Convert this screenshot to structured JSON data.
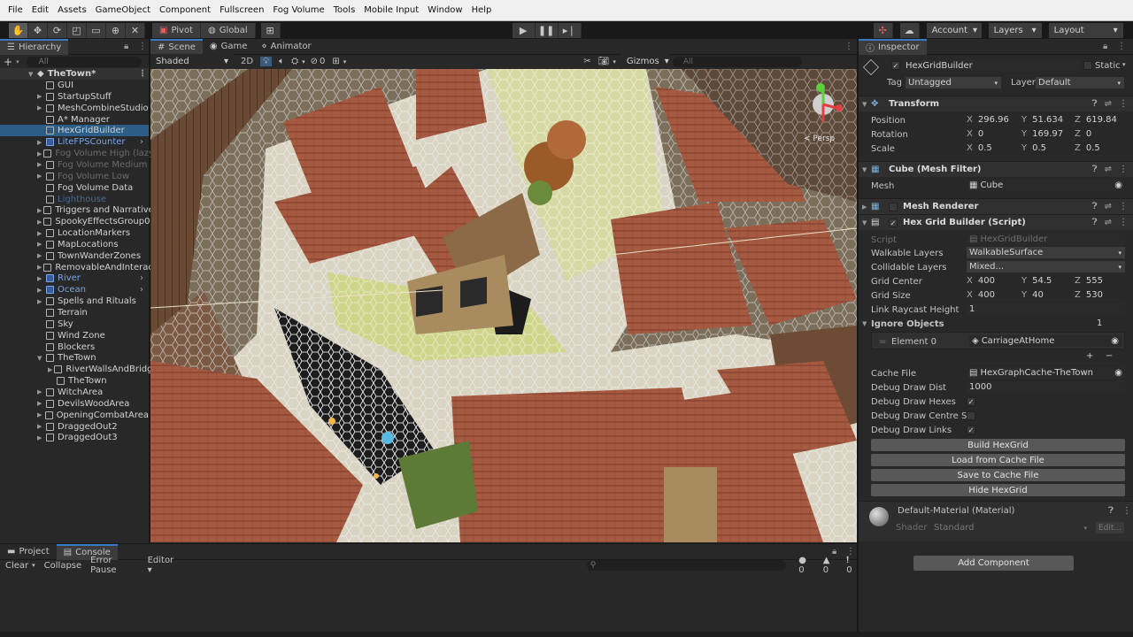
{
  "menu": [
    "File",
    "Edit",
    "Assets",
    "GameObject",
    "Component",
    "Fullscreen",
    "Fog Volume",
    "Tools",
    "Mobile Input",
    "Window",
    "Help"
  ],
  "toolbar": {
    "pivot": "Pivot",
    "global": "Global",
    "account": "Account",
    "layers": "Layers",
    "layout": "Layout"
  },
  "hierarchy": {
    "title": "Hierarchy",
    "search_placeholder": "All",
    "root": "TheTown*",
    "items": [
      {
        "label": "GUI",
        "style": "normal"
      },
      {
        "label": "StartupStuff",
        "style": "normal"
      },
      {
        "label": "MeshCombineStudio",
        "style": "normal"
      },
      {
        "label": "A* Manager",
        "style": "normal"
      },
      {
        "label": "HexGridBuilder",
        "style": "selected"
      },
      {
        "label": "LiteFPSCounter",
        "style": "blue"
      },
      {
        "label": "Fog Volume High (lazy",
        "style": "dim"
      },
      {
        "label": "Fog Volume Medium",
        "style": "dim"
      },
      {
        "label": "Fog Volume Low",
        "style": "dim"
      },
      {
        "label": "Fog Volume Data",
        "style": "normal"
      },
      {
        "label": "Lighthouse",
        "style": "dimblue"
      },
      {
        "label": "Triggers and Narrative",
        "style": "normal"
      },
      {
        "label": "SpookyEffectsGroup0",
        "style": "normal"
      },
      {
        "label": "LocationMarkers",
        "style": "normal"
      },
      {
        "label": "MapLocations",
        "style": "normal"
      },
      {
        "label": "TownWanderZones",
        "style": "normal"
      },
      {
        "label": "RemovableAndInteract",
        "style": "normal"
      },
      {
        "label": "River",
        "style": "blue"
      },
      {
        "label": "Ocean",
        "style": "blue"
      },
      {
        "label": "Spells and Rituals",
        "style": "normal"
      },
      {
        "label": "Terrain",
        "style": "normal"
      },
      {
        "label": "Sky",
        "style": "normal"
      },
      {
        "label": "Wind Zone",
        "style": "normal"
      },
      {
        "label": "Blockers",
        "style": "normal"
      },
      {
        "label": "TheTown",
        "style": "normal"
      },
      {
        "label": "RiverWallsAndBridge",
        "style": "normal"
      },
      {
        "label": "TheTown",
        "style": "normal"
      },
      {
        "label": "WitchArea",
        "style": "normal"
      },
      {
        "label": "DevilsWoodArea",
        "style": "normal"
      },
      {
        "label": "OpeningCombatArea",
        "style": "normal"
      },
      {
        "label": "DraggedOut2",
        "style": "normal"
      },
      {
        "label": "DraggedOut3",
        "style": "normal"
      }
    ]
  },
  "scene": {
    "tabs": [
      "Scene",
      "Game",
      "Animator"
    ],
    "shading": "Shaded",
    "mode2d": "2D",
    "effects_count": "0",
    "gizmos": "Gizmos",
    "search_placeholder": "All",
    "persp": "< Persp"
  },
  "inspector": {
    "title": "Inspector",
    "object_name": "HexGridBuilder",
    "static": "Static",
    "tag_label": "Tag",
    "tag": "Untagged",
    "layer_label": "Layer",
    "layer": "Default",
    "transform": {
      "title": "Transform",
      "position_label": "Position",
      "position": [
        "296.96",
        "51.634",
        "619.84"
      ],
      "rotation_label": "Rotation",
      "rotation": [
        "0",
        "169.97",
        "0"
      ],
      "scale_label": "Scale",
      "scale": [
        "0.5",
        "0.5",
        "0.5"
      ]
    },
    "mesh_filter": {
      "title": "Cube (Mesh Filter)",
      "mesh_label": "Mesh",
      "mesh": "Cube"
    },
    "mesh_renderer": {
      "title": "Mesh Renderer"
    },
    "script": {
      "title": "Hex Grid Builder (Script)",
      "script_label": "Script",
      "script": "HexGridBuilder",
      "walkable_label": "Walkable Layers",
      "walkable": "WalkableSurface",
      "collidable_label": "Collidable Layers",
      "collidable": "Mixed...",
      "grid_center_label": "Grid Center",
      "grid_center": [
        "400",
        "54.5",
        "555"
      ],
      "grid_size_label": "Grid Size",
      "grid_size": [
        "400",
        "40",
        "530"
      ],
      "link_raycast_label": "Link Raycast Height",
      "link_raycast": "1",
      "ignore_label": "Ignore Objects",
      "ignore_count": "1",
      "element0_label": "Element 0",
      "element0": "CarriageAtHome",
      "cache_label": "Cache File",
      "cache": "HexGraphCache-TheTown",
      "debug_dist_label": "Debug Draw Dist",
      "debug_dist": "1000",
      "debug_hexes_label": "Debug Draw Hexes",
      "debug_centre_label": "Debug Draw Centre Spl",
      "debug_links_label": "Debug Draw Links"
    },
    "buttons": [
      "Build HexGrid",
      "Load from Cache File",
      "Save to Cache File",
      "Hide HexGrid"
    ],
    "material": {
      "name": "Default-Material (Material)",
      "shader_label": "Shader",
      "shader": "Standard",
      "edit": "Edit..."
    },
    "add_component": "Add Component"
  },
  "bottom": {
    "tabs": [
      "Project",
      "Console"
    ],
    "clear": "Clear",
    "collapse": "Collapse",
    "error_pause": "Error Pause",
    "editor": "Editor",
    "counts": [
      "0",
      "0",
      "0"
    ]
  },
  "colors": {
    "accent": "#3a79bb",
    "selected": "#2c5d87",
    "panel": "#282828",
    "roof": "#a3523c"
  }
}
